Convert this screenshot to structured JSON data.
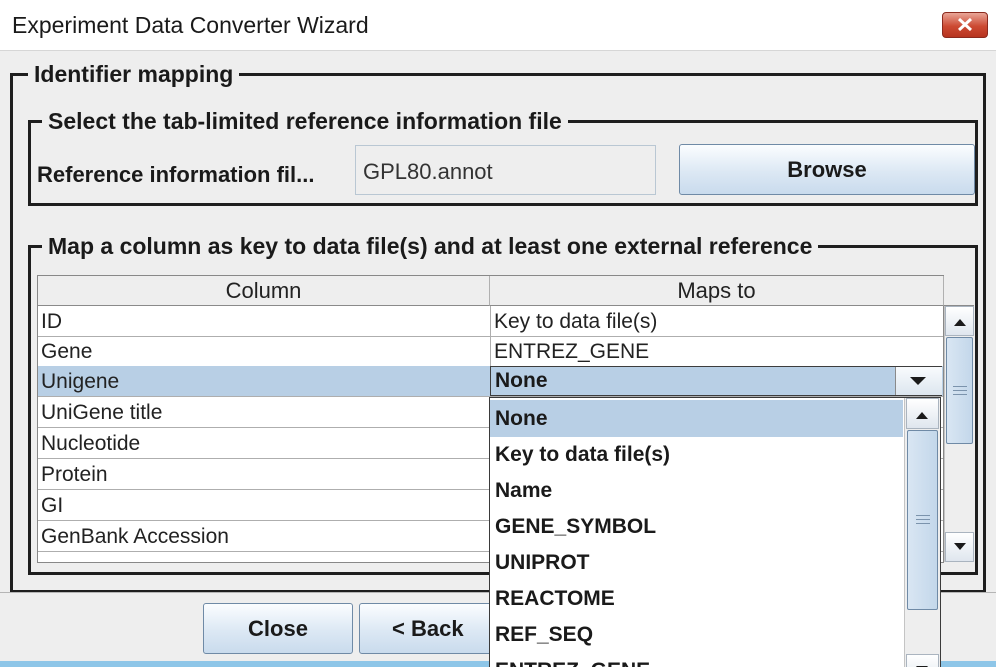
{
  "window": {
    "title": "Experiment Data Converter Wizard"
  },
  "groups": {
    "identifier": "Identifier mapping",
    "reference": "Select the tab-limited reference information file",
    "mapping": "Map a column as key to data file(s) and at least one external reference"
  },
  "reference": {
    "label": "Reference information fil...",
    "value": "GPL80.annot",
    "browse_label": "Browse"
  },
  "table": {
    "headers": [
      "Column",
      "Maps to"
    ],
    "rows": [
      {
        "column": "ID",
        "maps_to": "Key to data file(s)"
      },
      {
        "column": "Gene",
        "maps_to": "ENTREZ_GENE"
      },
      {
        "column": "Unigene",
        "maps_to": "None"
      },
      {
        "column": "UniGene title",
        "maps_to": ""
      },
      {
        "column": "Nucleotide",
        "maps_to": ""
      },
      {
        "column": "Protein",
        "maps_to": ""
      },
      {
        "column": "GI",
        "maps_to": ""
      },
      {
        "column": "GenBank Accession",
        "maps_to": ""
      }
    ],
    "selected_row": 2
  },
  "dropdown": {
    "selected": "None",
    "options": [
      "None",
      "Key to data file(s)",
      "Name",
      "GENE_SYMBOL",
      "UNIPROT",
      "REACTOME",
      "REF_SEQ",
      "ENTREZ_GENE"
    ]
  },
  "buttons": {
    "close": "Close",
    "back": "< Back"
  },
  "colors": {
    "selection": "#b8cfe5",
    "button_gradient_bottom": "#c9dbed",
    "close_button": "#cc4a33"
  }
}
